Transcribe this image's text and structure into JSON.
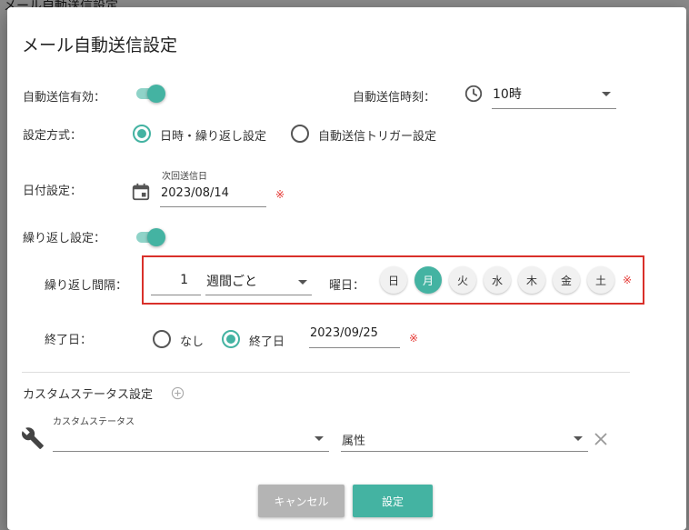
{
  "background_title": "メール自動送信設定",
  "dialog": {
    "title": "メール自動送信設定",
    "auto_send_enabled_label": "自動送信有効：",
    "auto_send_time_label": "自動送信時刻：",
    "auto_send_time_value": "10時",
    "method_label": "設定方式：",
    "method_options": [
      "日時・繰り返し設定",
      "自動送信トリガー設定"
    ],
    "date_label": "日付設定：",
    "next_send_date_caption": "次回送信日",
    "next_send_date_value": "2023/08/14",
    "required_mark": "※",
    "repeat_label": "繰り返し設定：",
    "interval_label": "繰り返し間隔：",
    "interval_value": "1",
    "interval_unit": "週間ごと",
    "weekday_label": "曜日：",
    "weekdays": [
      "日",
      "月",
      "火",
      "水",
      "木",
      "金",
      "土"
    ],
    "selected_weekday": "月",
    "end_date_label": "終了日：",
    "end_options": [
      "なし",
      "終了日"
    ],
    "end_date_value": "2023/09/25",
    "custom_status_title": "カスタムステータス設定",
    "custom_status_caption": "カスタムステータス",
    "attribute_placeholder": "属性",
    "cancel_label": "キャンセル",
    "confirm_label": "設定"
  },
  "colors": {
    "accent": "#44b3a2",
    "required": "#e53935",
    "highlight_border": "#d9302a",
    "cancel_button": "#b4b4b4"
  },
  "icons": [
    "clock-icon",
    "calendar-icon",
    "add-circle-icon",
    "wrench-icon",
    "close-icon",
    "chevron-down-icon"
  ]
}
